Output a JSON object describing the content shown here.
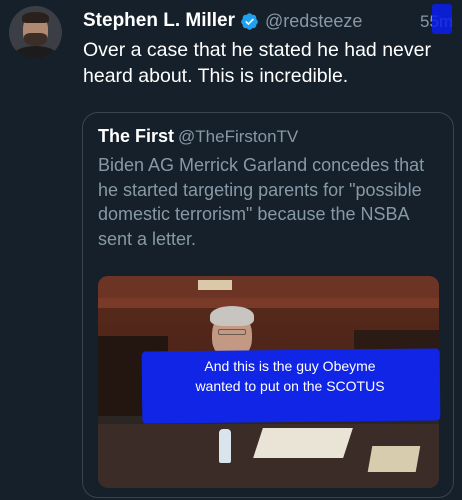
{
  "tweet": {
    "author_name": "Stephen L. Miller",
    "handle": "@redsteeze",
    "timestamp": "55m",
    "verified_icon": "verified-badge-icon",
    "text": "Over a case that he stated he had never heard about. This is incredible."
  },
  "quoted_tweet": {
    "author_name": "The First",
    "handle": "@TheFirstonTV",
    "text": "Biden AG Merrick Garland concedes that he started targeting parents for \"possible domestic terrorism\" because the NSBA sent a letter."
  },
  "overlay": {
    "caption": "And this is the guy Obeyme wanted to put on the SCOTUS"
  },
  "colors": {
    "background": "#15202b",
    "secondary_text": "#8899a6",
    "verified_blue": "#1da1f2",
    "overlay_blue": "#1125e6"
  }
}
